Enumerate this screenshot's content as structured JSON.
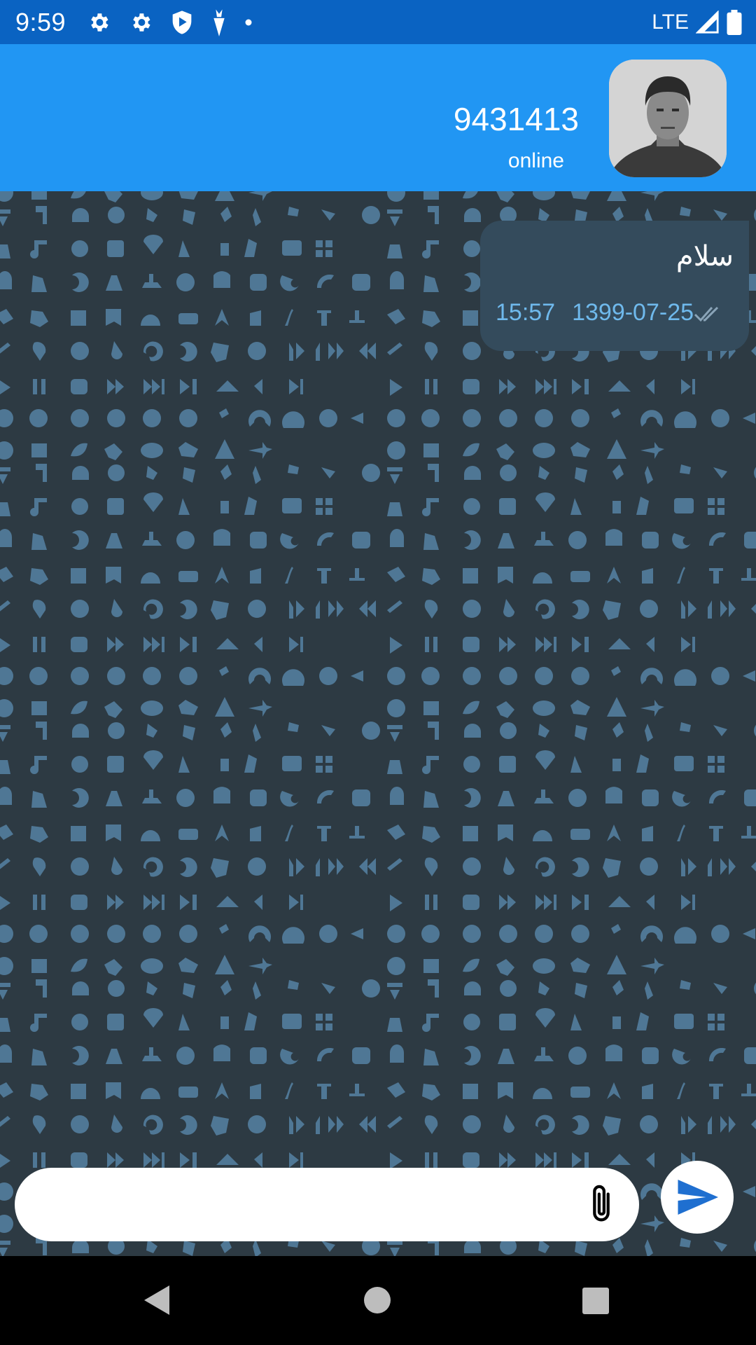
{
  "status_bar": {
    "time": "9:59",
    "network": "LTE",
    "icons": [
      "gear-icon",
      "gear-icon",
      "shield-play-icon",
      "carrot-icon",
      "dot-icon",
      "signal-icon",
      "battery-icon"
    ]
  },
  "header": {
    "contact_name": "9431413",
    "contact_status": "online",
    "avatar": "avatar-photo",
    "background_color": "#2196f3"
  },
  "chat": {
    "background_color": "#2d3a43",
    "messages": [
      {
        "text": "سلام",
        "time": "15:57",
        "date": "1399-07-25",
        "status_icon": "double-check-icon"
      }
    ]
  },
  "composer": {
    "placeholder": "",
    "attach_icon": "paperclip-icon",
    "send_icon": "send-icon"
  },
  "navigation": {
    "icons": [
      "back-icon",
      "home-icon",
      "recents-icon"
    ]
  },
  "colors": {
    "status_bar": "#0a63c2",
    "accent": "#2196f3",
    "bubble": "#344b5c",
    "meta_text": "#6fb9ec",
    "pattern": "#4f7795"
  }
}
